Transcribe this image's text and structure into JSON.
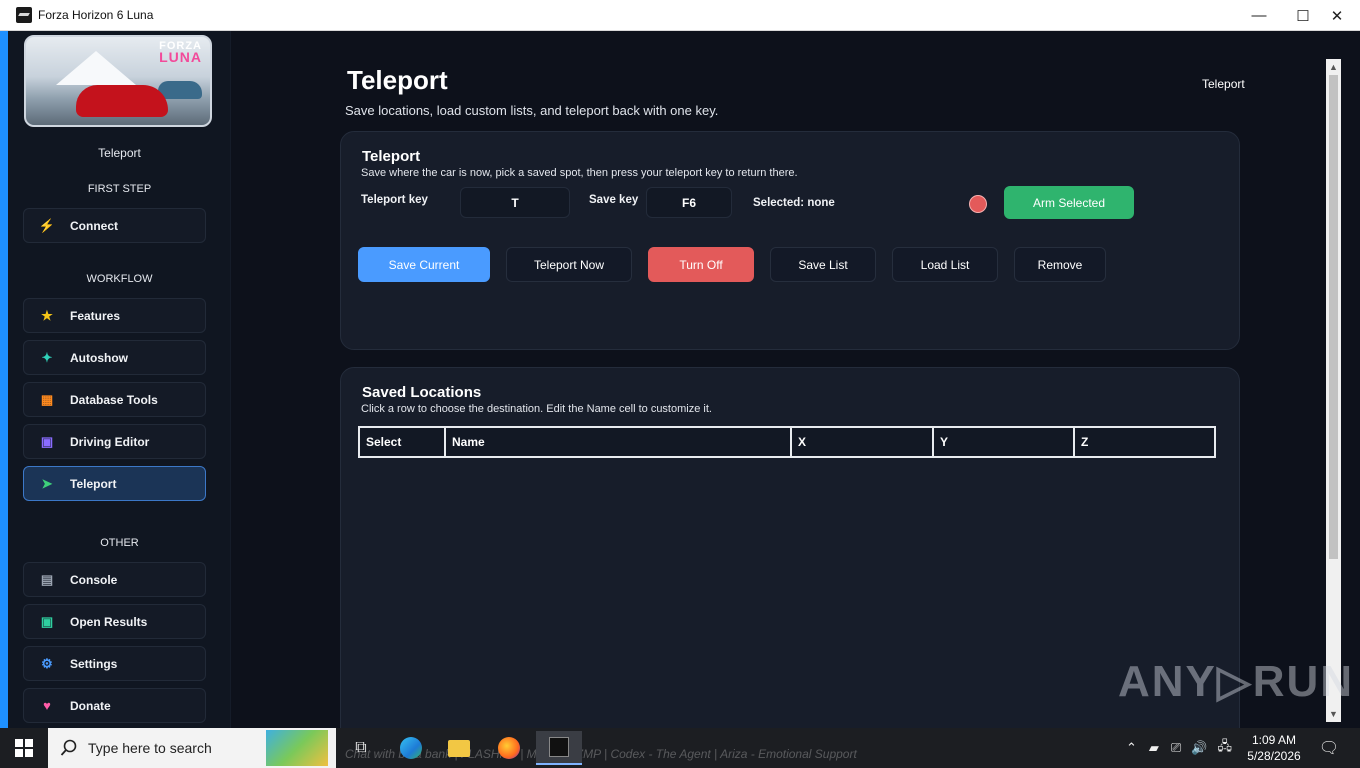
{
  "window": {
    "title": "Forza Horizon 6 Luna",
    "minimize": "—",
    "maximize": "☐",
    "close": "✕"
  },
  "logo": {
    "line1": "FORZA",
    "line2": "LUNA"
  },
  "sidebar": {
    "current": "Teleport",
    "sections": {
      "first_step": "FIRST STEP",
      "workflow": "WORKFLOW",
      "other": "OTHER"
    },
    "items": [
      {
        "label": "Connect",
        "icon": "⚡",
        "color": "#4a9bff"
      },
      {
        "label": "Features",
        "icon": "★",
        "color": "#f5c518"
      },
      {
        "label": "Autoshow",
        "icon": "✦",
        "color": "#2fd0b8"
      },
      {
        "label": "Database Tools",
        "icon": "▦",
        "color": "#ff8a1e"
      },
      {
        "label": "Driving Editor",
        "icon": "▣",
        "color": "#8a6cff"
      },
      {
        "label": "Teleport",
        "icon": "➤",
        "color": "#3ed07a"
      },
      {
        "label": "Console",
        "icon": "▤",
        "color": "#9aa3b0"
      },
      {
        "label": "Open Results",
        "icon": "▣",
        "color": "#2fd0a0"
      },
      {
        "label": "Settings",
        "icon": "⚙",
        "color": "#4a9bff"
      },
      {
        "label": "Donate",
        "icon": "♥",
        "color": "#ff5ca8"
      }
    ]
  },
  "header": {
    "title": "Teleport",
    "subtitle": "Save locations, load custom lists, and teleport back with one key.",
    "breadcrumb": "Teleport"
  },
  "teleport_card": {
    "title": "Teleport",
    "description": "Save where the car is now, pick a saved spot, then press your teleport key to return there.",
    "teleport_key_label": "Teleport key",
    "teleport_key_value": "T",
    "save_key_label": "Save key",
    "save_key_value": "F6",
    "selected_text": "Selected: none",
    "arm_button": "Arm Selected",
    "buttons": {
      "save_current": "Save Current",
      "teleport_now": "Teleport Now",
      "turn_off": "Turn Off",
      "save_list": "Save List",
      "load_list": "Load List",
      "remove": "Remove"
    }
  },
  "locations_card": {
    "title": "Saved Locations",
    "description": "Click a row to choose the destination. Edit the Name cell to customize it.",
    "columns": [
      "Select",
      "Name",
      "X",
      "Y",
      "Z"
    ]
  },
  "watermark": "ANY▷RUN",
  "taskbar": {
    "search_placeholder": "Type here to search",
    "background_text": "Chat with be a bank  |  FLASHM -   |  Map  |  BEZMP  |  Codex - The Agent  |  Ariza - Emotional Support",
    "time": "1:09 AM",
    "date": "5/28/2026"
  }
}
